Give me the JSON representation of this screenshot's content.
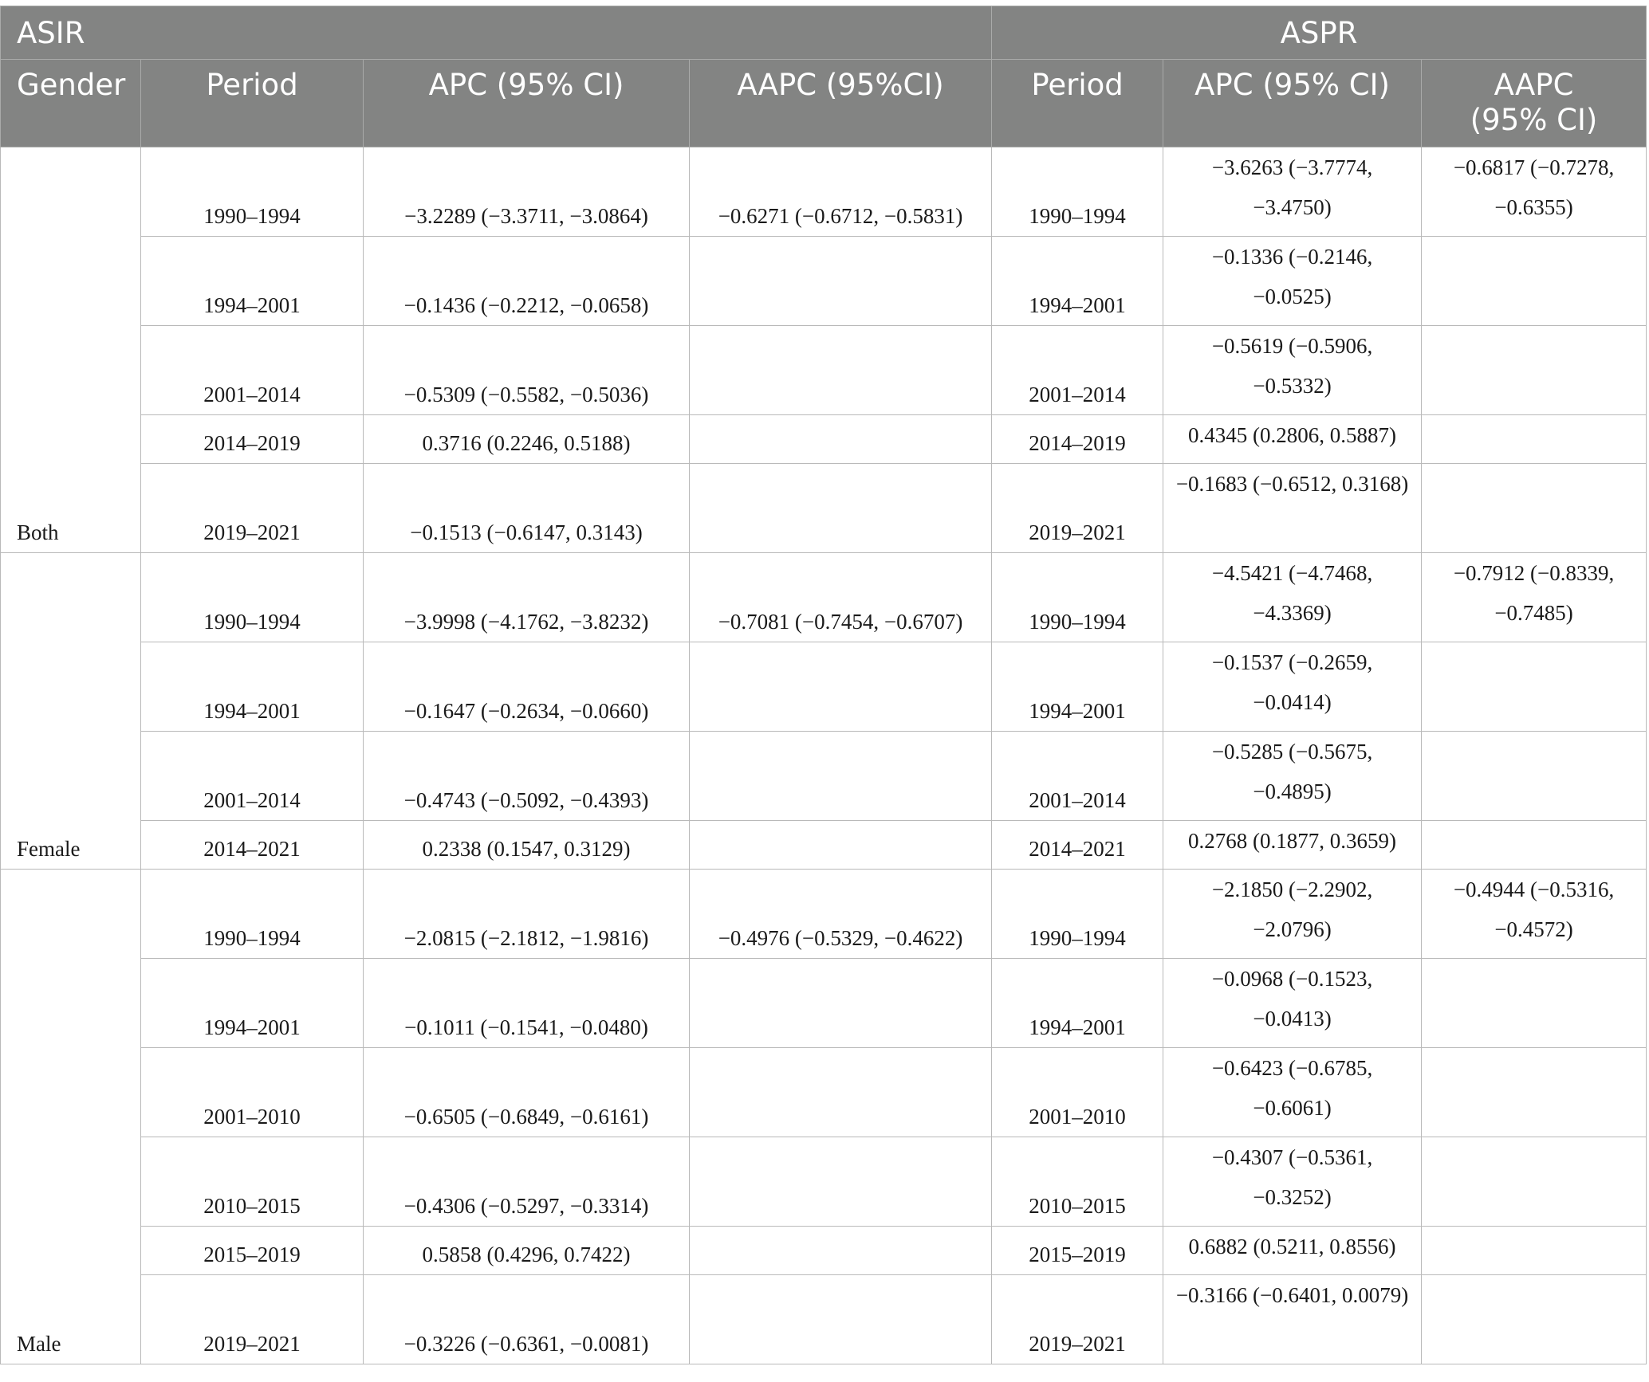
{
  "header": {
    "group_asir": "ASIR",
    "group_aspr": "ASPR",
    "gender": "Gender",
    "period": "Period",
    "apc": "APC (95% CI)",
    "aapc_asir": "AAPC (95%CI)",
    "aspr_period": "Period",
    "aspr_apc": "APC (95% CI)",
    "aapc_aspr": "AAPC (95% CI)"
  },
  "groups": [
    {
      "gender": "Both",
      "rows": [
        {
          "period": "1990–1994",
          "apc": "−3.2289 (−3.3711, −3.0864)",
          "aapc": "−0.6271 (−0.6712, −0.5831)",
          "aspr_period": "1990–1994",
          "aspr_apc": "−3.6263 (−3.7774, −3.4750)",
          "aspr_aapc": "−0.6817 (−0.7278, −0.6355)"
        },
        {
          "period": "1994–2001",
          "apc": "−0.1436 (−0.2212, −0.0658)",
          "aapc": "",
          "aspr_period": "1994–2001",
          "aspr_apc": "−0.1336 (−0.2146, −0.0525)",
          "aspr_aapc": ""
        },
        {
          "period": "2001–2014",
          "apc": "−0.5309 (−0.5582, −0.5036)",
          "aapc": "",
          "aspr_period": "2001–2014",
          "aspr_apc": "−0.5619 (−0.5906, −0.5332)",
          "aspr_aapc": ""
        },
        {
          "period": "2014–2019",
          "apc": "0.3716 (0.2246, 0.5188)",
          "aapc": "",
          "aspr_period": "2014–2019",
          "aspr_apc": "0.4345 (0.2806, 0.5887)",
          "aspr_aapc": ""
        },
        {
          "period": "2019–2021",
          "apc": "−0.1513 (−0.6147, 0.3143)",
          "aapc": "",
          "aspr_period": "2019–2021",
          "aspr_apc": "−0.1683 (−0.6512, 0.3168)",
          "aspr_aapc": ""
        }
      ]
    },
    {
      "gender": "Female",
      "rows": [
        {
          "period": "1990–1994",
          "apc": "−3.9998 (−4.1762, −3.8232)",
          "aapc": "−0.7081 (−0.7454, −0.6707)",
          "aspr_period": "1990–1994",
          "aspr_apc": "−4.5421 (−4.7468, −4.3369)",
          "aspr_aapc": "−0.7912 (−0.8339, −0.7485)"
        },
        {
          "period": "1994–2001",
          "apc": "−0.1647 (−0.2634, −0.0660)",
          "aapc": "",
          "aspr_period": "1994–2001",
          "aspr_apc": "−0.1537 (−0.2659, −0.0414)",
          "aspr_aapc": ""
        },
        {
          "period": "2001–2014",
          "apc": "−0.4743 (−0.5092, −0.4393)",
          "aapc": "",
          "aspr_period": "2001–2014",
          "aspr_apc": "−0.5285 (−0.5675, −0.4895)",
          "aspr_aapc": ""
        },
        {
          "period": "2014–2021",
          "apc": "0.2338 (0.1547, 0.3129)",
          "aapc": "",
          "aspr_period": "2014–2021",
          "aspr_apc": "0.2768 (0.1877, 0.3659)",
          "aspr_aapc": ""
        }
      ]
    },
    {
      "gender": "Male",
      "rows": [
        {
          "period": "1990–1994",
          "apc": "−2.0815 (−2.1812, −1.9816)",
          "aapc": "−0.4976 (−0.5329, −0.4622)",
          "aspr_period": "1990–1994",
          "aspr_apc": "−2.1850 (−2.2902, −2.0796)",
          "aspr_aapc": "−0.4944 (−0.5316, −0.4572)"
        },
        {
          "period": "1994–2001",
          "apc": "−0.1011 (−0.1541, −0.0480)",
          "aapc": "",
          "aspr_period": "1994–2001",
          "aspr_apc": "−0.0968 (−0.1523, −0.0413)",
          "aspr_aapc": ""
        },
        {
          "period": "2001–2010",
          "apc": "−0.6505 (−0.6849, −0.6161)",
          "aapc": "",
          "aspr_period": "2001–2010",
          "aspr_apc": "−0.6423 (−0.6785, −0.6061)",
          "aspr_aapc": ""
        },
        {
          "period": "2010–2015",
          "apc": "−0.4306 (−0.5297, −0.3314)",
          "aapc": "",
          "aspr_period": "2010–2015",
          "aspr_apc": "−0.4307 (−0.5361, −0.3252)",
          "aspr_aapc": ""
        },
        {
          "period": "2015–2019",
          "apc": "0.5858 (0.4296, 0.7422)",
          "aapc": "",
          "aspr_period": "2015–2019",
          "aspr_apc": "0.6882 (0.5211, 0.8556)",
          "aspr_aapc": ""
        },
        {
          "period": "2019–2021",
          "apc": "−0.3226 (−0.6361, −0.0081)",
          "aapc": "",
          "aspr_period": "2019–2021",
          "aspr_apc": "−0.3166 (−0.6401, 0.0079)",
          "aspr_aapc": ""
        }
      ]
    }
  ]
}
